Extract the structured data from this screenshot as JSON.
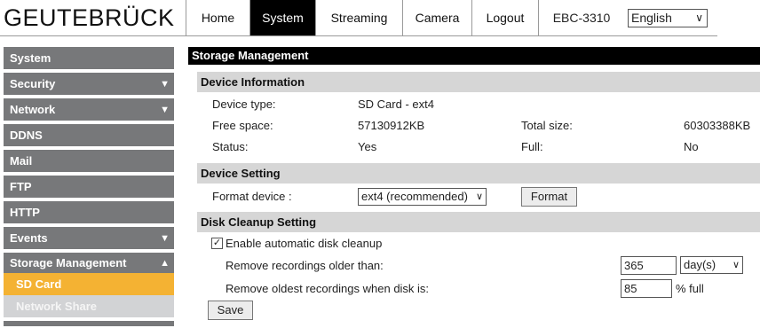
{
  "header": {
    "logo": "GEUTEBRÜCK",
    "tabs": [
      "Home",
      "System",
      "Streaming",
      "Camera",
      "Logout"
    ],
    "active_tab": "System",
    "model": "EBC-3310",
    "language": "English"
  },
  "sidebar": {
    "items": [
      {
        "label": "System",
        "arrow": ""
      },
      {
        "label": "Security",
        "arrow": "▼"
      },
      {
        "label": "Network",
        "arrow": "▼"
      },
      {
        "label": "DDNS",
        "arrow": ""
      },
      {
        "label": "Mail",
        "arrow": ""
      },
      {
        "label": "FTP",
        "arrow": ""
      },
      {
        "label": "HTTP",
        "arrow": ""
      },
      {
        "label": "Events",
        "arrow": "▼"
      },
      {
        "label": "Storage Management",
        "arrow": "▲"
      }
    ],
    "subitems": [
      "SD Card",
      "Network Share"
    ]
  },
  "main": {
    "title": "Storage Management",
    "device_info": {
      "heading": "Device Information",
      "device_type_label": "Device type:",
      "device_type_value": "SD Card - ext4",
      "free_space_label": "Free space:",
      "free_space_value": "57130912KB",
      "total_size_label": "Total size:",
      "total_size_value": "60303388KB",
      "status_label": "Status:",
      "status_value": "Yes",
      "full_label": "Full:",
      "full_value": "No"
    },
    "device_setting": {
      "heading": "Device Setting",
      "format_label": "Format device :",
      "format_select": "ext4 (recommended)",
      "format_button": "Format"
    },
    "cleanup": {
      "heading": "Disk Cleanup Setting",
      "enable_label": "Enable automatic disk cleanup",
      "enable_checked": true,
      "older_label": "Remove recordings older than:",
      "older_value": "365",
      "older_unit": "day(s)",
      "oldest_label": "Remove oldest recordings when disk is:",
      "oldest_value": "85",
      "oldest_unit": "% full",
      "save_button": "Save"
    }
  }
}
